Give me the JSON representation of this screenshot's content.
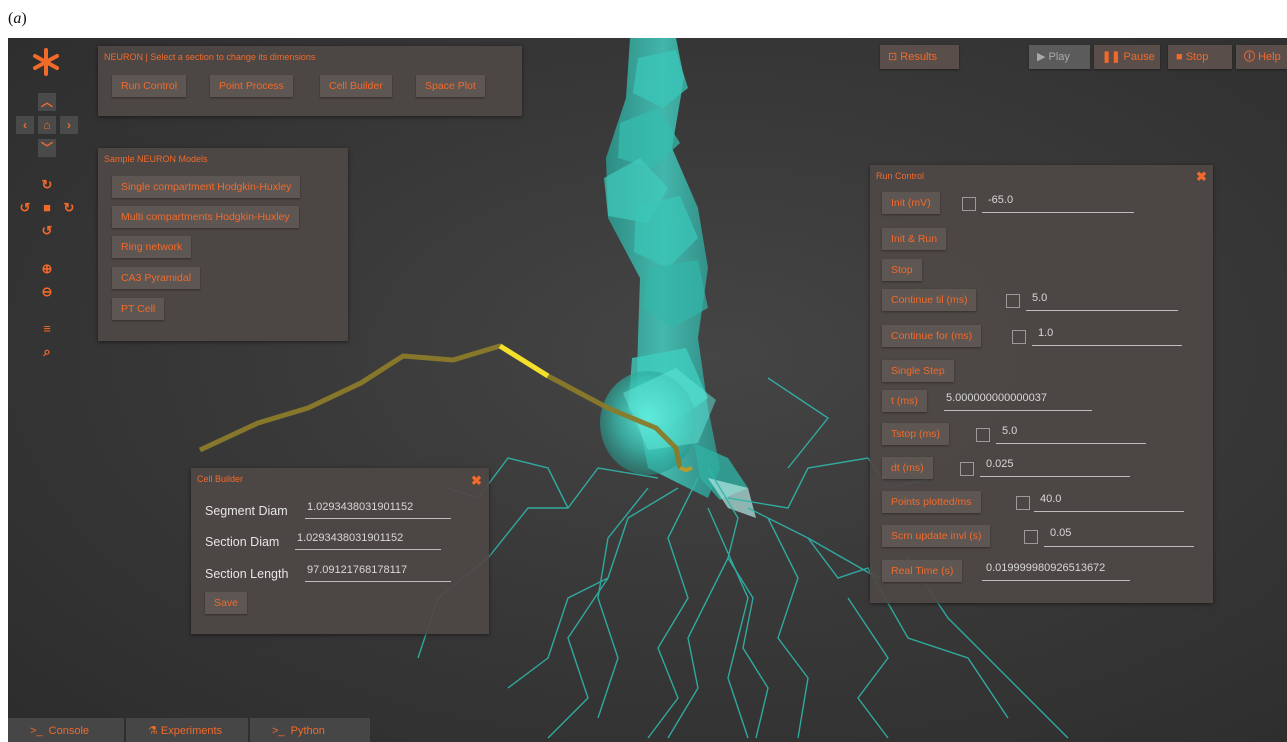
{
  "figure_label": "a",
  "toolbar": {
    "results_label": "Results",
    "play_label": "▶ Play",
    "pause_label": "Pause",
    "stop_label": "Stop",
    "help_label": "Help"
  },
  "neuron_panel": {
    "title": "NEURON | Select a section to change its dimensions",
    "buttons": [
      "Run Control",
      "Point Process",
      "Cell Builder",
      "Space Plot"
    ]
  },
  "models_panel": {
    "title": "Sample NEURON Models",
    "buttons": [
      "Single compartment Hodgkin-Huxley",
      "Multi compartments Hodgkin-Huxley",
      "Ring network",
      "CA3 Pyramidal",
      "PT Cell"
    ]
  },
  "cell_builder": {
    "title": "Cell Builder",
    "close_glyph": "✖",
    "fields": [
      {
        "label": "Segment Diam",
        "value": "1.0293438031901152"
      },
      {
        "label": "Section Diam",
        "value": "1.0293438031901152"
      },
      {
        "label": "Section Length",
        "value": "97.09121768178117"
      }
    ],
    "save_label": "Save"
  },
  "run_control": {
    "title": "Run Control",
    "close_glyph": "✖",
    "rows": [
      {
        "button": "Init (mV)",
        "checkbox": true,
        "value": "-65.0"
      },
      {
        "button": "Init & Run",
        "checkbox": false,
        "value": null
      },
      {
        "button": "Stop",
        "checkbox": false,
        "value": null
      },
      {
        "button": "Continue til (ms)",
        "checkbox": true,
        "value": "5.0"
      },
      {
        "button": "Continue for (ms)",
        "checkbox": true,
        "value": "1.0"
      },
      {
        "button": "Single Step",
        "checkbox": false,
        "value": null
      },
      {
        "button": "t (ms)",
        "checkbox": false,
        "value": "5.000000000000037"
      },
      {
        "button": "Tstop (ms)",
        "checkbox": true,
        "value": "5.0"
      },
      {
        "button": "dt (ms)",
        "checkbox": true,
        "value": "0.025"
      },
      {
        "button": "Points plotted/ms",
        "checkbox": true,
        "value": "40.0"
      },
      {
        "button": "Scrn update invl (s)",
        "checkbox": true,
        "value": "0.05"
      },
      {
        "button": "Real Time (s)",
        "checkbox": false,
        "value": "0.019999980926513672"
      }
    ]
  },
  "bottom_tabs": [
    "Console",
    "Experiments",
    "Python"
  ],
  "colors": {
    "accent": "#f26a2a",
    "neuron_cyan": "#3ad1c4",
    "selected_dendrite": "#f2e02a",
    "dendrite_olive": "#8a7a2a"
  },
  "icons": {
    "logo": "asterisk-logo",
    "nav": [
      "chevron-up-icon",
      "chevron-left-icon",
      "home-icon",
      "chevron-right-icon",
      "chevron-down-icon",
      "rotate-cw-icon",
      "rotate-left-icon",
      "camera-icon",
      "rotate-right-icon",
      "rotate-ccw-icon",
      "zoom-in-icon",
      "zoom-out-icon",
      "list-icon",
      "search-icon"
    ]
  }
}
